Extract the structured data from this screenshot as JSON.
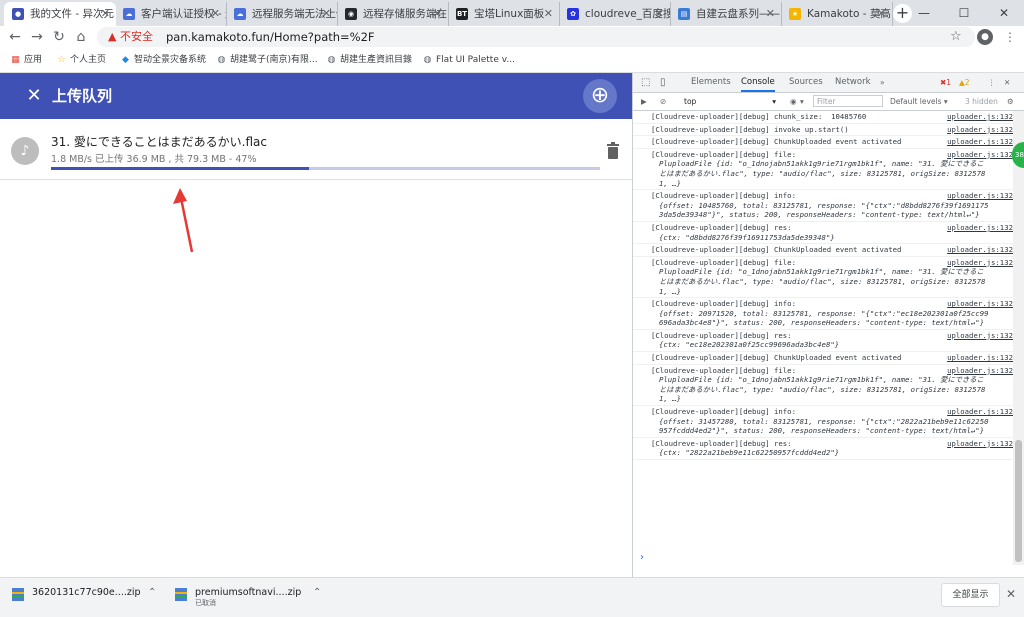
{
  "browser": {
    "tabs": [
      {
        "title": "我的文件 - 异次元",
        "favicon": "cloudreve",
        "color": "#3f51b5",
        "glyph": "●"
      },
      {
        "title": "客户端认证授权 - 远",
        "favicon": "cloud",
        "color": "#4a6fd8",
        "glyph": "☁"
      },
      {
        "title": "远程服务端无法上传",
        "favicon": "cloud",
        "color": "#4a6fd8",
        "glyph": "☁"
      },
      {
        "title": "远程存储服务端在",
        "favicon": "github",
        "color": "#24292e",
        "glyph": "◉"
      },
      {
        "title": "宝塔Linux面板",
        "favicon": "bt",
        "color": "#202124",
        "glyph": "BT"
      },
      {
        "title": "cloudreve_百度搜",
        "favicon": "baidu",
        "color": "#2932e1",
        "glyph": "✿"
      },
      {
        "title": "自建云盘系列——",
        "favicon": "doc",
        "color": "#3a7bd5",
        "glyph": "▤"
      },
      {
        "title": "Kamakoto - 莫高",
        "favicon": "star",
        "color": "#f4b400",
        "glyph": "★"
      }
    ],
    "new_tab": "+",
    "window": {
      "minimize": "—",
      "maximize": "☐",
      "close": "✕"
    },
    "nav": {
      "back": "←",
      "forward": "→",
      "reload": "↻",
      "home": "⌂"
    },
    "security_label": "不安全",
    "url": "pan.kamakoto.fun/Home?path=%2F",
    "bookmarks": [
      {
        "label": "应用",
        "icon": "apps-icon",
        "glyph": "▦",
        "color": "#ea4335"
      },
      {
        "label": "个人主页",
        "icon": "star-icon",
        "glyph": "☆",
        "color": "#f4b400"
      },
      {
        "label": "智动全景灾备系统",
        "icon": "drop-icon",
        "glyph": "◆",
        "color": "#1e88e5"
      },
      {
        "label": "胡建鹭子(南京)有限...",
        "icon": "globe-icon",
        "glyph": "◍",
        "color": "#5f6368"
      },
      {
        "label": "胡建生產資訊目錄",
        "icon": "globe-icon",
        "glyph": "◍",
        "color": "#5f6368"
      },
      {
        "label": "Flat UI Palette v...",
        "icon": "globe-icon",
        "glyph": "◍",
        "color": "#5f6368"
      }
    ]
  },
  "app": {
    "title": "上传队列",
    "upload": {
      "file_name": "31. 愛にできることはまだあるかい.flac",
      "status": "1.8 MB/s 已上传 36.9 MB , 共 79.3 MB - 47%",
      "progress": 0.47
    }
  },
  "devtools": {
    "tabs": [
      "Elements",
      "Console",
      "Sources",
      "Network"
    ],
    "active_tab": "Console",
    "more": "»",
    "errors": "1",
    "warnings": "2",
    "context": "top",
    "filter_placeholder": "Filter",
    "levels": "Default levels ▾",
    "hidden": "3 hidden",
    "badge": "38",
    "logs": [
      {
        "text": "[Cloudreve-uploader][debug] chunk_size:  10485760",
        "src": "uploader.js:132"
      },
      {
        "text": "[Cloudreve-uploader][debug] invoke up.start()",
        "src": "uploader.js:132"
      },
      {
        "text": "[Cloudreve-uploader][debug] ChunkUploaded event activated",
        "src": "uploader.js:132"
      },
      {
        "text": "[Cloudreve-uploader][debug] file:",
        "obj": "PluploadFile {id: \"o_1dnojabn51akk1g9rie71rgm1bk1f\", name: \"31. 愛にできることはまだあるかい.flac\", type: \"audio/flac\", size: 83125781, origSize: 83125781, …}",
        "src": "uploader.js:132"
      },
      {
        "text": "[Cloudreve-uploader][debug] info:",
        "obj": "{offset: 10485760, total: 83125781, response: \"{\"ctx\":\"d8bdd8276f39f16911753da5de39348\"}\", status: 200, responseHeaders: \"content-type: text/html↵\"}",
        "src": "uploader.js:132"
      },
      {
        "text": "[Cloudreve-uploader][debug] res:",
        "obj": "{ctx: \"d8bdd8276f39f16911753da5de39348\"}",
        "src": "uploader.js:132"
      },
      {
        "text": "[Cloudreve-uploader][debug] ChunkUploaded event activated",
        "src": "uploader.js:132"
      },
      {
        "text": "[Cloudreve-uploader][debug] file:",
        "obj": "PluploadFile {id: \"o_1dnojabn51akk1g9rie71rgm1bk1f\", name: \"31. 愛にできることはまだあるかい.flac\", type: \"audio/flac\", size: 83125781, origSize: 83125781, …}",
        "src": "uploader.js:132"
      },
      {
        "text": "[Cloudreve-uploader][debug] info:",
        "obj": "{offset: 20971520, total: 83125781, response: \"{\"ctx\":\"ec18e202301a0f25cc99696ada3bc4e8\"}\", status: 200, responseHeaders: \"content-type: text/html↵\"}",
        "src": "uploader.js:132"
      },
      {
        "text": "[Cloudreve-uploader][debug] res:",
        "obj": "{ctx: \"ec18e202301a0f25cc99696ada3bc4e8\"}",
        "src": "uploader.js:132"
      },
      {
        "text": "[Cloudreve-uploader][debug] ChunkUploaded event activated",
        "src": "uploader.js:132"
      },
      {
        "text": "[Cloudreve-uploader][debug] file:",
        "obj": "PluploadFile {id: \"o_1dnojabn51akk1g9rie71rgm1bk1f\", name: \"31. 愛にできることはまだあるかい.flac\", type: \"audio/flac\", size: 83125781, origSize: 83125781, …}",
        "src": "uploader.js:132"
      },
      {
        "text": "[Cloudreve-uploader][debug] info:",
        "obj": "{offset: 31457280, total: 83125781, response: \"{\"ctx\":\"2822a21beb9e11c62250957fcddd4ed2\"}\", status: 200, responseHeaders: \"content-type: text/html↵\"}",
        "src": "uploader.js:132"
      },
      {
        "text": "[Cloudreve-uploader][debug] res:",
        "obj": "{ctx: \"2822a21beb9e11c62250957fcddd4ed2\"}",
        "src": "uploader.js:132"
      }
    ],
    "prompt": "›"
  },
  "downloads": {
    "items": [
      {
        "name": "3620131c77c90e....zip",
        "sub": ""
      },
      {
        "name": "premiumsoftnavi....zip",
        "sub": "已取消"
      }
    ],
    "show_all": "全部显示"
  }
}
